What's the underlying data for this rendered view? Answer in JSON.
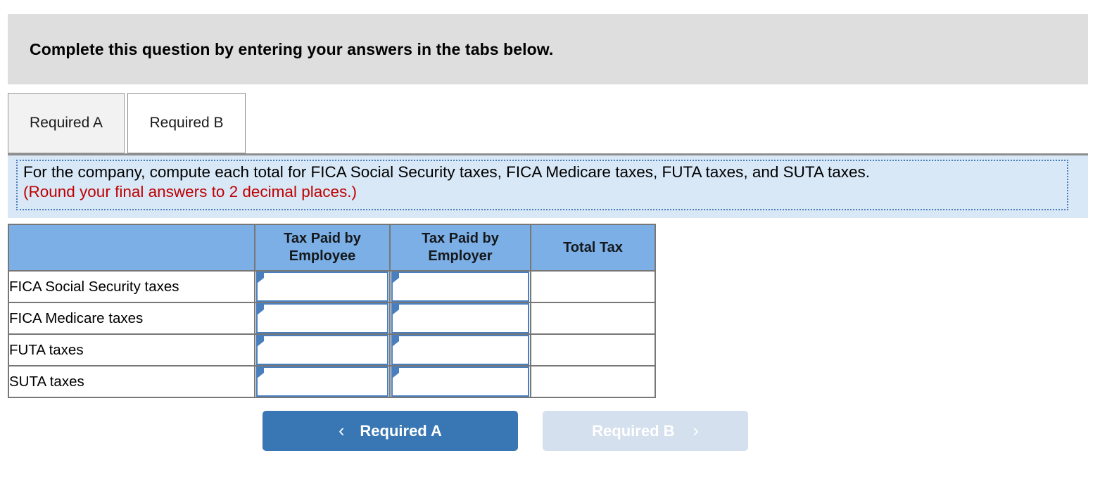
{
  "banner": {
    "text": "Complete this question by entering your answers in the tabs below."
  },
  "tabs": [
    {
      "label": "Required A",
      "state": "inactive"
    },
    {
      "label": "Required B",
      "state": "active"
    }
  ],
  "requirement": {
    "instruction": "For the company, compute each total for FICA Social Security taxes, FICA Medicare taxes, FUTA taxes, and SUTA taxes.",
    "rounding_note": "(Round your final answers to 2 decimal places.)",
    "rounding_color": "#c00000",
    "panel_bg": "#d8e8f7",
    "panel_border": "#4a7ebb"
  },
  "table": {
    "header_bg": "#7bafe5",
    "border_color": "#777777",
    "input_border": "#4a7fbf",
    "columns": [
      {
        "label": "",
        "key": "row_label"
      },
      {
        "label": "Tax Paid by Employee",
        "key": "employee"
      },
      {
        "label": "Tax Paid by Employer",
        "key": "employer"
      },
      {
        "label": "Total Tax",
        "key": "total"
      }
    ],
    "rows": [
      {
        "label": "FICA Social Security taxes",
        "employee": "",
        "employer": "",
        "total": ""
      },
      {
        "label": "FICA Medicare taxes",
        "employee": "",
        "employer": "",
        "total": ""
      },
      {
        "label": "FUTA taxes",
        "employee": "",
        "employer": "",
        "total": ""
      },
      {
        "label": "SUTA taxes",
        "employee": "",
        "employer": "",
        "total": ""
      }
    ]
  },
  "navigation": {
    "prev": {
      "label": "Required A",
      "icon": "chevron-left",
      "glyph": "‹",
      "enabled": true,
      "color": "#3876b4"
    },
    "next": {
      "label": "Required B",
      "icon": "chevron-right",
      "glyph": "›",
      "enabled": false,
      "color": "#d5e0ef"
    }
  }
}
